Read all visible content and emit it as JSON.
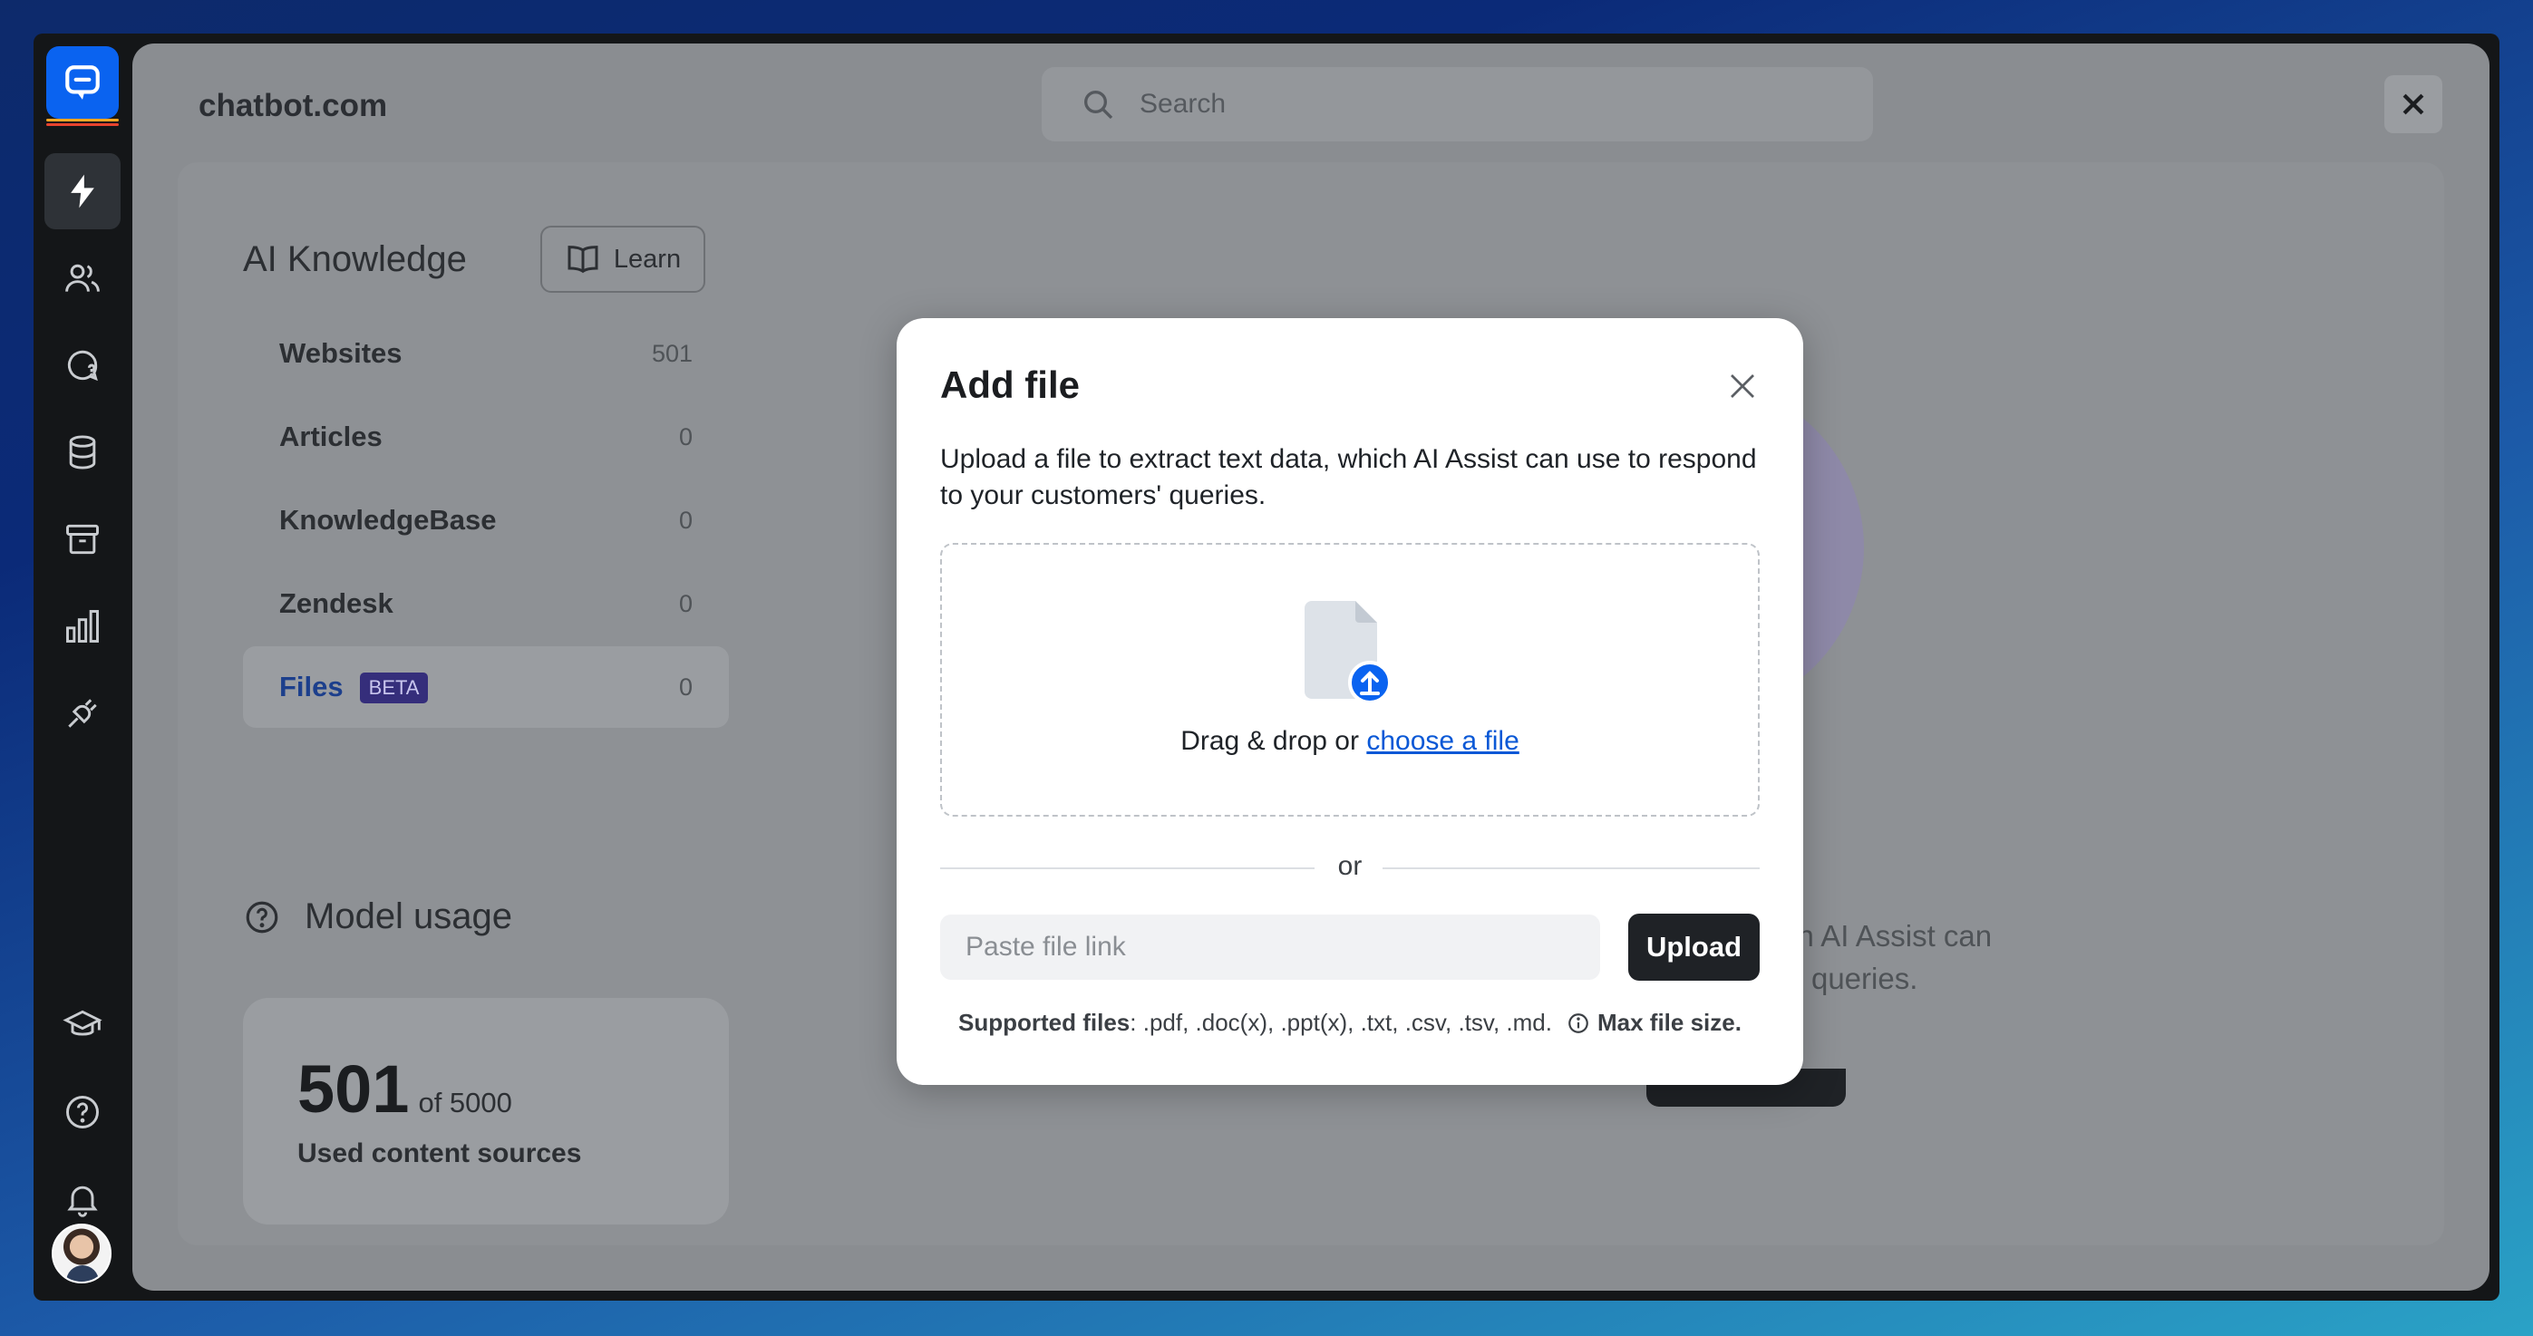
{
  "org_name": "chatbot.com",
  "search": {
    "placeholder": "Search"
  },
  "knowledge": {
    "title": "AI Knowledge",
    "learn_label": "Learn",
    "items": [
      {
        "label": "Websites",
        "count": "501"
      },
      {
        "label": "Articles",
        "count": "0"
      },
      {
        "label": "KnowledgeBase",
        "count": "0"
      },
      {
        "label": "Zendesk",
        "count": "0"
      },
      {
        "label": "Files",
        "badge": "BETA",
        "count": "0",
        "active": true
      }
    ]
  },
  "model_usage": {
    "title": "Model usage",
    "used": "501",
    "of_label": "of 5000",
    "label": "Used content sources"
  },
  "background_text": {
    "line1": "ch AI Assist can",
    "line2": "s' queries."
  },
  "modal": {
    "title": "Add file",
    "description": "Upload a file to extract text data, which AI Assist can use to respond to your customers' queries.",
    "drop_text": "Drag & drop or",
    "choose_link": "choose a file",
    "or": "or",
    "link_placeholder": "Paste file link",
    "upload_label": "Upload",
    "supported_label": "Supported files",
    "supported_types": ": .pdf, .doc(x), .ppt(x), .txt, .csv, .tsv, .md.",
    "max_size_label": "Max file size."
  },
  "colors": {
    "brand_blue": "#0a63f0",
    "sidebar_bg": "#141618",
    "beta_badge": "#352e7b",
    "link_blue": "#0a58d6"
  }
}
